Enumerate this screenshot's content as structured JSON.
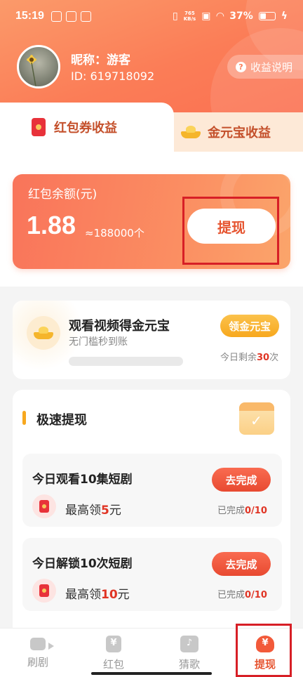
{
  "status_bar": {
    "time": "15:19",
    "net_speed_value": "765",
    "net_speed_unit": "KB/s",
    "battery": "37%"
  },
  "profile": {
    "nickname": "昵称：游客",
    "id": "ID: 619718092",
    "earnings_info_label": "收益说明"
  },
  "tabs": [
    {
      "label": "红包券收益",
      "icon": "red-packet-icon",
      "active": true
    },
    {
      "label": "金元宝收益",
      "icon": "gold-ingot-icon",
      "active": false
    }
  ],
  "balance": {
    "label": "红包余额(元)",
    "amount": "1.88",
    "approx": "≈188000个",
    "withdraw_label": "提现"
  },
  "video_task": {
    "title": "观看视频得金元宝",
    "subtitle": "无门槛秒到账",
    "button_label": "领金元宝",
    "remaining_prefix": "今日剩余",
    "remaining_count": "30",
    "remaining_suffix": "次"
  },
  "fast_withdraw": {
    "title": "极速提现",
    "tasks": [
      {
        "title": "今日观看10集短剧",
        "reward_prefix": "最高领",
        "reward_value": "5",
        "reward_suffix": "元",
        "button_label": "去完成",
        "progress_prefix": "已完成",
        "progress_value": "0/10"
      },
      {
        "title": "今日解锁10次短剧",
        "reward_prefix": "最高领",
        "reward_value": "10",
        "reward_suffix": "元",
        "button_label": "去完成",
        "progress_prefix": "已完成",
        "progress_value": "0/10"
      }
    ]
  },
  "bottom_nav": [
    {
      "label": "刷剧",
      "icon": "video-play-icon",
      "active": false
    },
    {
      "label": "红包",
      "icon": "red-packet-icon",
      "active": false
    },
    {
      "label": "猜歌",
      "icon": "music-note-icon",
      "active": false
    },
    {
      "label": "提现",
      "icon": "money-bag-icon",
      "active": true
    }
  ],
  "colors": {
    "accent": "#fb7d57",
    "highlight_box": "#d71f26",
    "reward_red": "#e03525",
    "gold": "#f7a81e"
  }
}
